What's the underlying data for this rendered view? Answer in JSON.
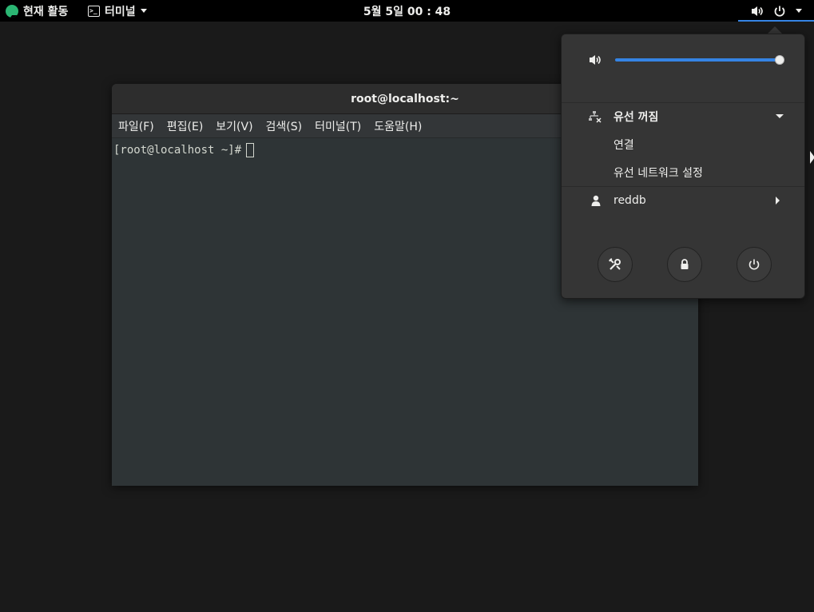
{
  "topbar": {
    "activities_label": "현재 활동",
    "app_menu_label": "터미널",
    "clock": "5월 5일  00 : 48"
  },
  "terminal": {
    "title": "root@localhost:~",
    "menu": [
      "파일(F)",
      "편집(E)",
      "보기(V)",
      "검색(S)",
      "터미널(T)",
      "도움말(H)"
    ],
    "prompt": "[root@localhost ~]#"
  },
  "system_menu": {
    "volume_percent": 100,
    "network": {
      "title": "유선 꺼짐",
      "connect": "연결",
      "settings": "유선 네트워크 설정"
    },
    "user_name": "reddb",
    "buttons": [
      "settings-icon",
      "lock-icon",
      "power-icon"
    ]
  },
  "colors": {
    "accent": "#3584e4",
    "panel": "#000000",
    "popover_bg": "#353535",
    "terminal_bg": "#2e3436",
    "logo": "#2bb673"
  }
}
